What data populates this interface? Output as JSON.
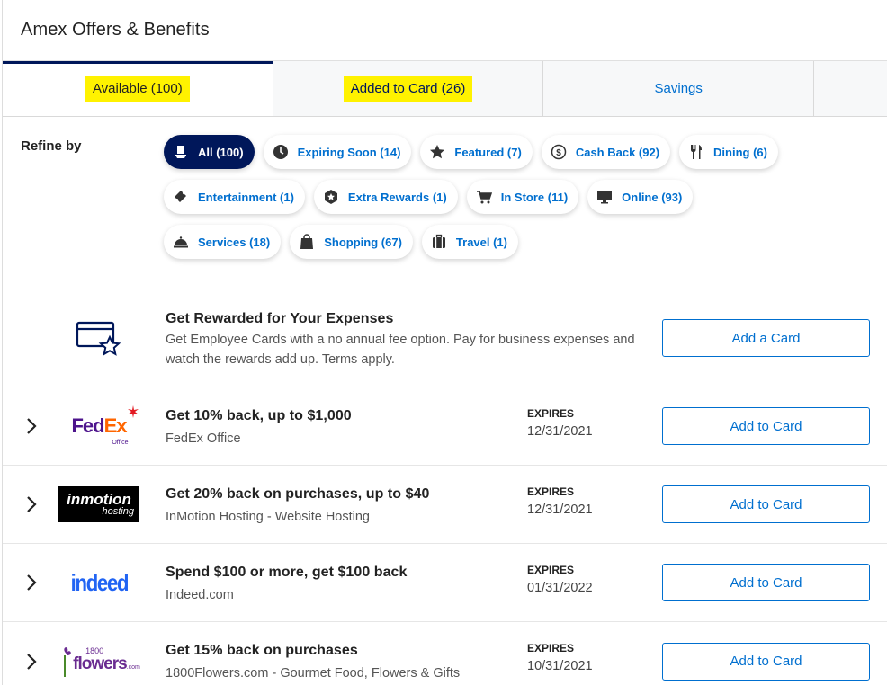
{
  "header": {
    "title": "Amex Offers & Benefits"
  },
  "tabs": [
    {
      "label": "Available (100)"
    },
    {
      "label": "Added to Card (26)"
    },
    {
      "label": "Savings"
    }
  ],
  "refine": {
    "label": "Refine by",
    "chips": [
      {
        "label": "All (100)",
        "icon": "all-icon"
      },
      {
        "label": "Expiring Soon (14)",
        "icon": "clock-icon"
      },
      {
        "label": "Featured (7)",
        "icon": "star-icon"
      },
      {
        "label": "Cash Back (92)",
        "icon": "cash-icon"
      },
      {
        "label": "Dining (6)",
        "icon": "fork-knife-icon"
      },
      {
        "label": "Entertainment (1)",
        "icon": "ticket-icon"
      },
      {
        "label": "Extra Rewards (1)",
        "icon": "hexagon-star-icon"
      },
      {
        "label": "In Store (11)",
        "icon": "cart-icon"
      },
      {
        "label": "Online (93)",
        "icon": "monitor-icon"
      },
      {
        "label": "Services (18)",
        "icon": "bell-icon"
      },
      {
        "label": "Shopping (67)",
        "icon": "bag-icon"
      },
      {
        "label": "Travel (1)",
        "icon": "luggage-icon"
      }
    ]
  },
  "promo": {
    "title": "Get Rewarded for Your Expenses",
    "description": "Get Employee Cards with a no annual fee option. Pay for business expenses and watch the rewards add up. Terms apply.",
    "button": "Add a Card"
  },
  "offers": [
    {
      "title": "Get 10% back, up to $1,000",
      "merchant": "FedEx Office",
      "expires_label": "EXPIRES",
      "expires": "12/31/2021",
      "button": "Add to Card",
      "logo": {
        "main1": "Fed",
        "main2": "Ex",
        "small": "Office"
      }
    },
    {
      "title": "Get 20% back on purchases, up to $40",
      "merchant": "InMotion Hosting - Website Hosting",
      "expires_label": "EXPIRES",
      "expires": "12/31/2021",
      "button": "Add to Card",
      "logo": {
        "main": "inmotion",
        "small": "hosting"
      }
    },
    {
      "title": "Spend $100 or more, get $100 back",
      "merchant": "Indeed.com",
      "expires_label": "EXPIRES",
      "expires": "01/31/2022",
      "button": "Add to Card",
      "logo": {
        "main": "indeed"
      }
    },
    {
      "title": "Get 15% back on purchases",
      "merchant": "1800Flowers.com - Gourmet Food, Flowers & Gifts",
      "expires_label": "EXPIRES",
      "expires": "10/31/2021",
      "button": "Add to Card",
      "logo": {
        "top": "1800",
        "main": "flowers",
        "small": ".com"
      }
    }
  ],
  "colors": {
    "navy": "#00175a",
    "blue": "#006fcf",
    "highlight": "#fff200"
  }
}
